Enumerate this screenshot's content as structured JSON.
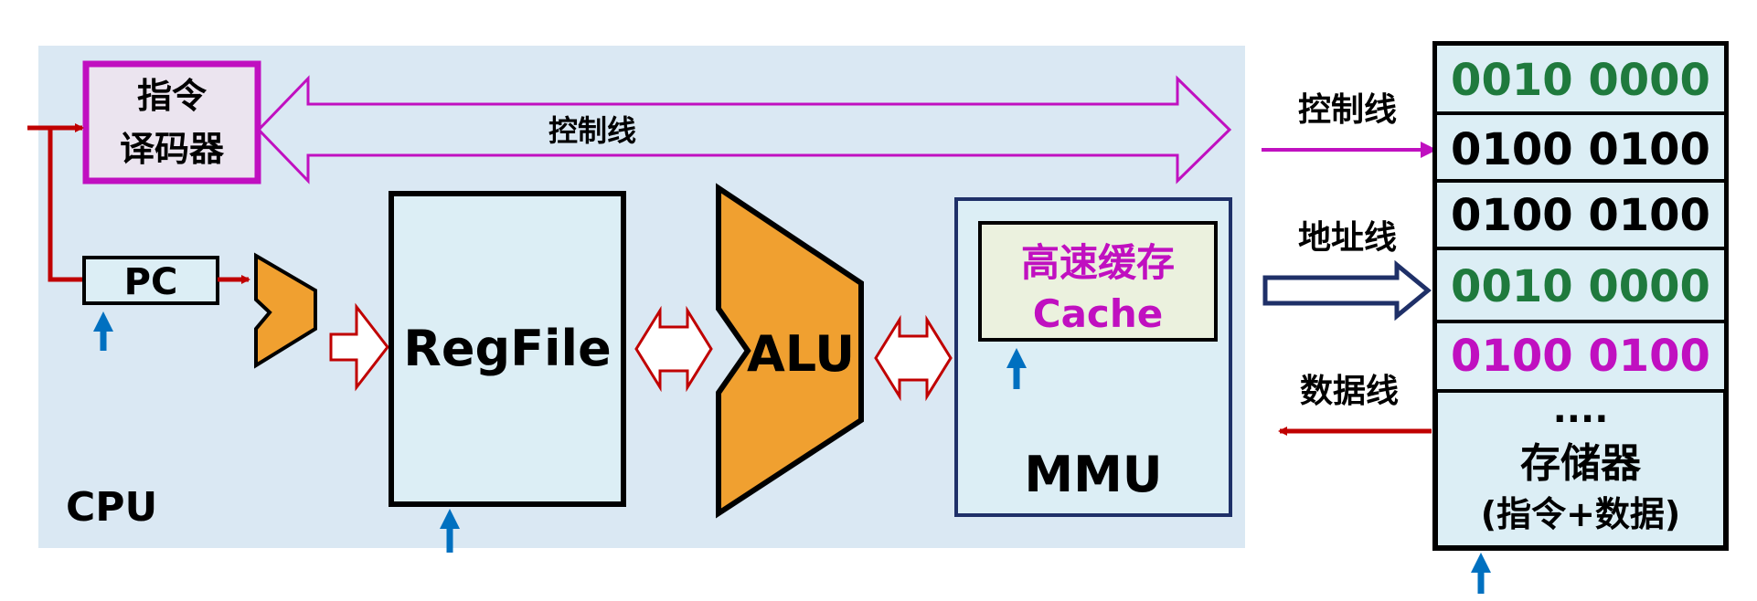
{
  "cpu": {
    "label": "CPU",
    "decoder": {
      "line1": "指令",
      "line2": "译码器"
    },
    "control_bus_label": "控制线",
    "pc_label": "PC",
    "regfile_label": "RegFile",
    "alu_label": "ALU",
    "cache": {
      "line1": "高速缓存",
      "line2": "Cache"
    },
    "mmu_label": "MMU"
  },
  "buses": {
    "control_label": "控制线",
    "address_label": "地址线",
    "data_label": "数据线"
  },
  "memory": {
    "cells": [
      {
        "value": "0010 0000",
        "color": "#1f7a3d"
      },
      {
        "value": "0100 0100",
        "color": "#000000"
      },
      {
        "value": "0100 0100",
        "color": "#000000"
      },
      {
        "value": "0010 0000",
        "color": "#1f7a3d"
      },
      {
        "value": "0100 0100",
        "color": "#c010c0"
      }
    ],
    "ellipsis": "....",
    "title": "存储器",
    "subtitle": "(指令+数据)"
  },
  "colors": {
    "cpu_bg": "#dae8f3",
    "magenta": "#c010c0",
    "red": "#c00000",
    "blue": "#0070c0",
    "orange": "#f0a030",
    "navy": "#1f3068",
    "cell_bg": "#dceef5",
    "cache_bg": "#ebf1de"
  }
}
